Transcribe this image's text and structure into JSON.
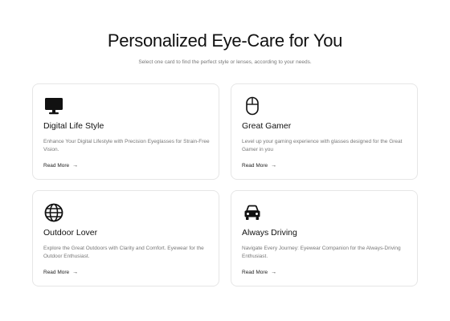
{
  "header": {
    "title": "Personalized Eye-Care for You",
    "subtitle": "Select one card to find the perfect style or lenses, according to your needs."
  },
  "cards": [
    {
      "icon": "monitor-icon",
      "title": "Digital Life Style",
      "description": "Enhance Your Digital Lifestyle with Precision Eyeglasses for Strain-Free Vision.",
      "link": "Read More"
    },
    {
      "icon": "mouse-icon",
      "title": "Great Gamer",
      "description": "Level up your gaming experience with glasses designed for the Great Gamer in you",
      "link": "Read More"
    },
    {
      "icon": "globe-icon",
      "title": "Outdoor Lover",
      "description": "Explore the Great Outdoors with Clarity and Comfort. Eyewear for the Outdoor Enthusiast.",
      "link": "Read More"
    },
    {
      "icon": "car-icon",
      "title": "Always Driving",
      "description": "Navigate Every Journey: Eyewear Companion for the Always-Driving Enthusiast.",
      "link": "Read More"
    }
  ],
  "arrow_glyph": "→"
}
